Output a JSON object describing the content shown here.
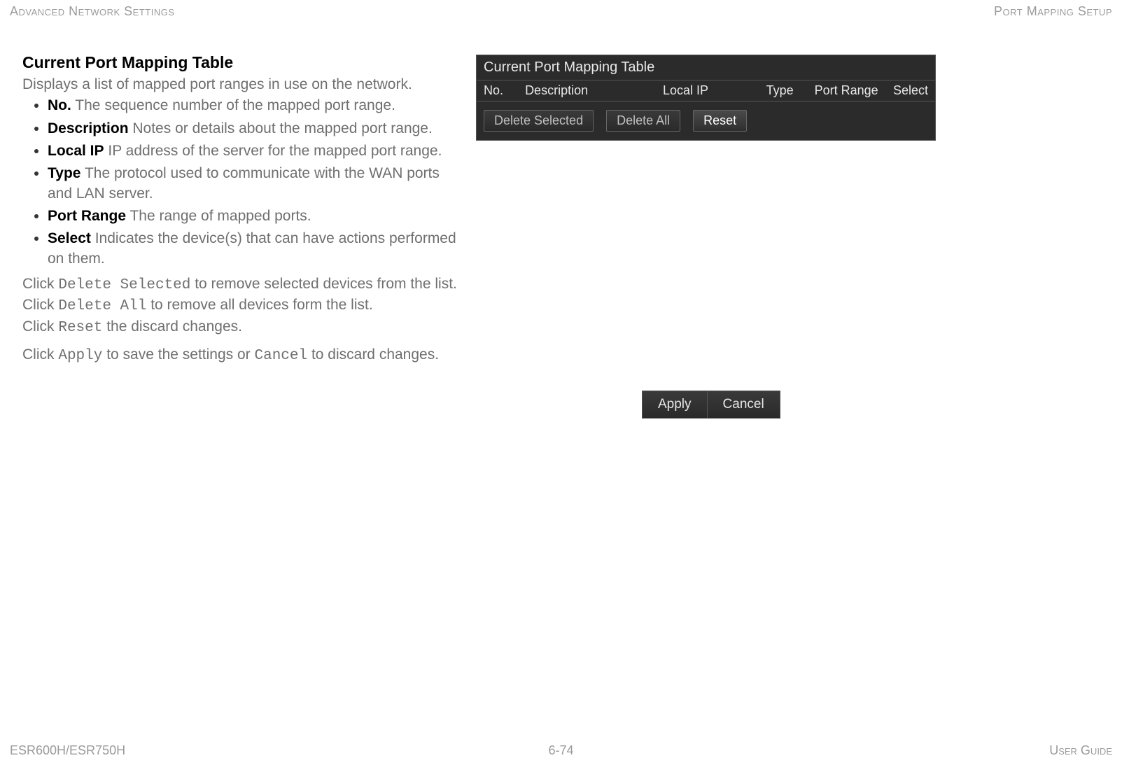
{
  "header": {
    "left": "Advanced Network Settings",
    "right": "Port Mapping Setup"
  },
  "footer": {
    "left": "ESR600H/ESR750H",
    "center": "6-74",
    "right": "User Guide"
  },
  "content": {
    "title": "Current Port Mapping Table",
    "subtitle": "Displays a list of mapped port ranges in use on the network.",
    "defs": [
      {
        "term": "No.",
        "desc": "The sequence number of the mapped port range."
      },
      {
        "term": "Description",
        "desc": "Notes or details about the mapped port range."
      },
      {
        "term": "Local IP",
        "desc": "IP address of the server for the mapped port range."
      },
      {
        "term": "Type",
        "desc": "The protocol used to communicate with the WAN ports and LAN server."
      },
      {
        "term": "Port Range",
        "desc": "The range of mapped ports."
      },
      {
        "term": "Select",
        "desc": "Indicates the device(s) that can have actions performed on them."
      }
    ],
    "actions": {
      "click": "Click ",
      "delete_selected_cmd": "Delete Selected",
      "delete_selected_rest": " to remove selected devices from the list.",
      "delete_all_cmd": "Delete All",
      "delete_all_rest": " to remove all devices form the list.",
      "reset_cmd": "Reset",
      "reset_rest": " the discard changes.",
      "apply_cmd": "Apply",
      "apply_mid": " to save the settings or ",
      "cancel_cmd": "Cancel",
      "apply_rest": " to discard changes."
    }
  },
  "table_panel": {
    "title": "Current Port Mapping Table",
    "cols": {
      "no": "No.",
      "description": "Description",
      "local_ip": "Local IP",
      "type": "Type",
      "port_range": "Port Range",
      "select": "Select"
    },
    "buttons": {
      "delete_selected": "Delete Selected",
      "delete_all": "Delete All",
      "reset": "Reset"
    }
  },
  "apply_panel": {
    "apply": "Apply",
    "cancel": "Cancel"
  }
}
